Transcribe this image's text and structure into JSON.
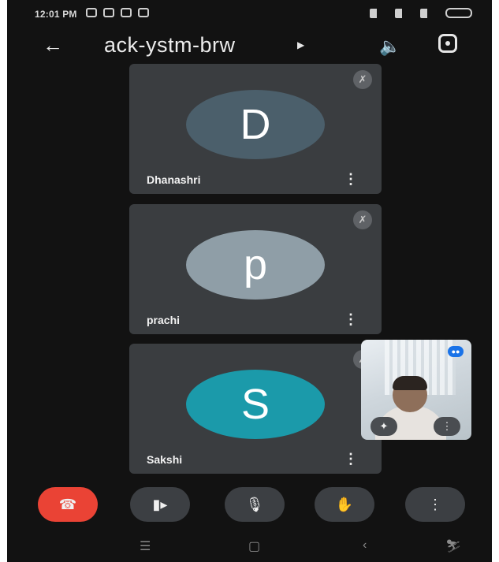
{
  "status_bar": {
    "time": "12:01 PM"
  },
  "header": {
    "back_icon": "arrow-left-icon",
    "meeting_code": "ack-ystm-brw",
    "caret_icon": "triangle-right-icon",
    "speaker_icon": "speaker-icon",
    "switch_camera_icon": "switch-camera-icon"
  },
  "participants": [
    {
      "initial": "D",
      "name": "Dhanashri",
      "avatar_color": "#4b5f6b",
      "muted": true
    },
    {
      "initial": "p",
      "name": "prachi",
      "avatar_color": "#8f9ea7",
      "muted": true
    },
    {
      "initial": "S",
      "name": "Sakshi",
      "avatar_color": "#1b9aaa",
      "muted": true
    }
  ],
  "self_view": {
    "badge_icon": "meeting-indicator-icon",
    "effects_icon": "sparkle-icon",
    "more_icon": "more-vertical-icon"
  },
  "controls": [
    {
      "name": "end-call",
      "icon": "phone-hangup-icon",
      "color": "#ea4335"
    },
    {
      "name": "camera",
      "icon": "video-camera-icon",
      "color": "#3c3f43"
    },
    {
      "name": "microphone",
      "icon": "microphone-icon",
      "color": "#3c3f43"
    },
    {
      "name": "raise-hand",
      "icon": "hand-icon",
      "color": "#3c3f43"
    },
    {
      "name": "more",
      "icon": "more-vertical-icon",
      "color": "#3c3f43"
    }
  ],
  "nav_bar": {
    "icons": [
      "menu-icon",
      "home-icon",
      "back-icon",
      "accessibility-icon"
    ]
  }
}
